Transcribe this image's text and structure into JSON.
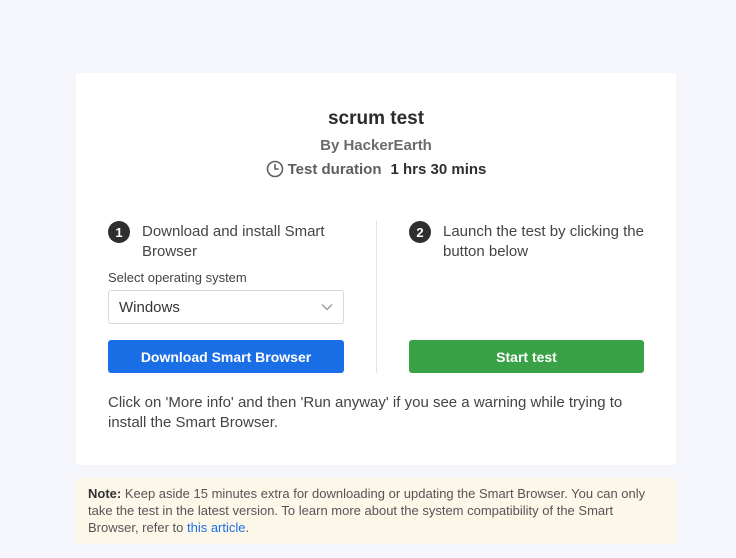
{
  "test": {
    "title": "scrum test",
    "byline": "By HackerEarth",
    "duration_label": "Test duration",
    "duration_value": "1 hrs 30 mins"
  },
  "step1": {
    "number": "1",
    "text": "Download and install Smart Browser",
    "os_label": "Select operating system",
    "os_selected": "Windows",
    "download_button": "Download Smart Browser"
  },
  "step2": {
    "number": "2",
    "text": "Launch the test by clicking the button below",
    "start_button": "Start test"
  },
  "info_text": "Click on 'More info' and then 'Run anyway' if you see a warning while trying to install the Smart Browser.",
  "note": {
    "label": "Note:",
    "text": " Keep aside 15 minutes extra for downloading or updating the Smart Browser. You can only take the test in the latest version. To learn more about the system compatibility of the Smart Browser, refer to ",
    "link_text": "this article",
    "end": "."
  },
  "icons": {
    "clock": "clock-icon",
    "dropdown": "chevron-down-icon"
  },
  "colors": {
    "primary": "#1a6ee6",
    "success": "#3aa246",
    "note_bg": "#fdf7e9"
  }
}
